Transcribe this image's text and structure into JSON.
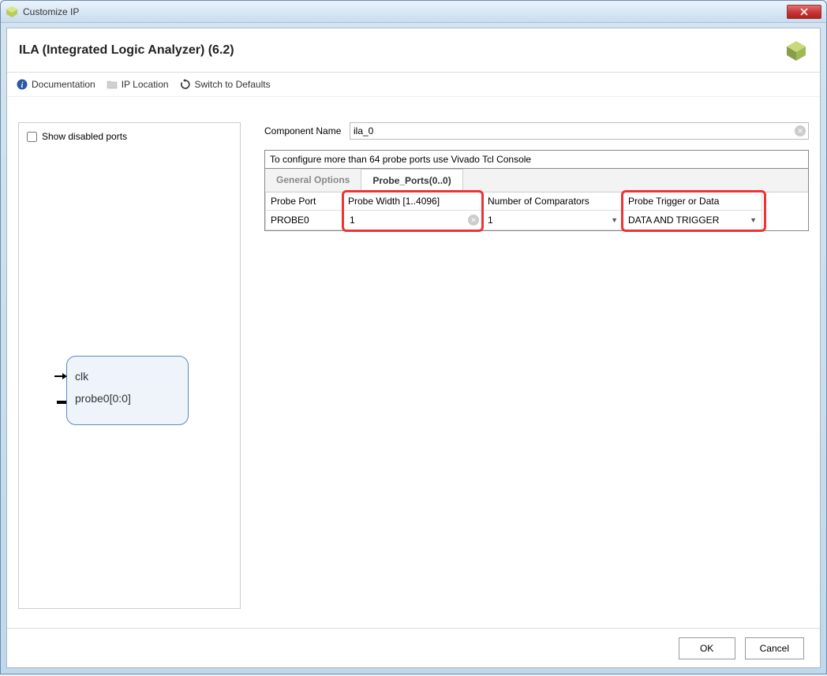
{
  "window": {
    "title": "Customize IP"
  },
  "header": {
    "title": "ILA (Integrated Logic Analyzer) (6.2)"
  },
  "toolbar": {
    "doc": "Documentation",
    "iploc": "IP Location",
    "defaults": "Switch to Defaults"
  },
  "left": {
    "show_disabled_label": "Show disabled ports",
    "show_disabled_checked": false,
    "ports": {
      "clk": "clk",
      "probe0": "probe0[0:0]"
    }
  },
  "right": {
    "component_name_label": "Component Name",
    "component_name_value": "ila_0",
    "hint": "To configure more than 64 probe ports use Vivado Tcl Console",
    "tabs": {
      "general": "General Options",
      "probe": "Probe_Ports(0..0)"
    },
    "table": {
      "headers": {
        "probe_port": "Probe Port",
        "probe_width": "Probe Width [1..4096]",
        "num_comp": "Number of Comparators",
        "trig_data": "Probe Trigger or Data"
      },
      "row": {
        "probe_port": "PROBE0",
        "probe_width": "1",
        "num_comp": "1",
        "trig_data": "DATA AND TRIGGER"
      }
    }
  },
  "footer": {
    "ok": "OK",
    "cancel": "Cancel"
  }
}
